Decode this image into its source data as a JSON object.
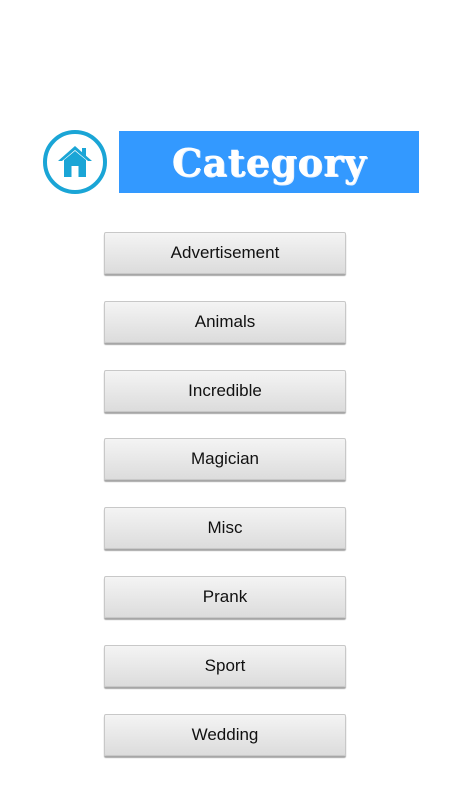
{
  "header": {
    "home_icon": "home-icon",
    "title": "Category"
  },
  "categories": [
    "Advertisement",
    "Animals",
    "Incredible",
    "Magician",
    "Misc",
    "Prank",
    "Sport",
    "Wedding"
  ],
  "colors": {
    "banner": "#3399ff",
    "home_ring": "#1aa5d6",
    "home_icon": "#1aa5d6",
    "button_bg": "#e6e6e6"
  }
}
